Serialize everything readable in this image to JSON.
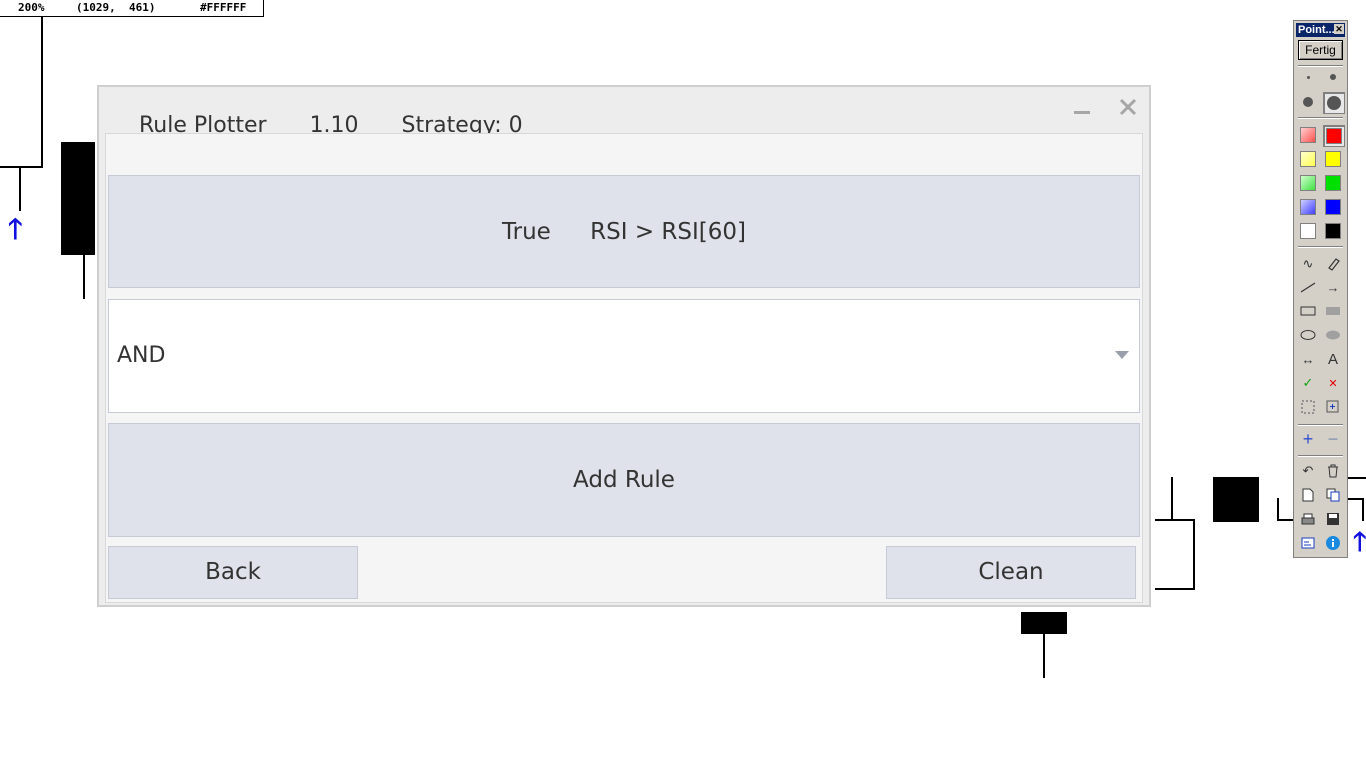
{
  "status": {
    "zoom": "200%",
    "coords": "(1029,  461)",
    "color": "#FFFFFF"
  },
  "dialog": {
    "title": "Rule Plotter",
    "version": "1.10",
    "strategy": "Strategy: 0",
    "rule": {
      "result": "True",
      "expression": "RSI > RSI[60]"
    },
    "operator": {
      "selected": "AND"
    },
    "add_rule_label": "Add Rule",
    "back_label": "Back",
    "clean_label": "Clean"
  },
  "toolbar": {
    "title": "Point...",
    "done_label": "Fertig",
    "colors": {
      "red_light": "#ff9a9a",
      "red": "#ff0000",
      "yellow_light": "#ffff88",
      "yellow": "#ffff00",
      "green_light": "#8aff8a",
      "green": "#00e000",
      "blue_light": "#8a8aff",
      "blue": "#0000ff",
      "white": "#ffffff",
      "black": "#000000"
    }
  },
  "chart": {
    "arrow_color": "#1010e0"
  }
}
